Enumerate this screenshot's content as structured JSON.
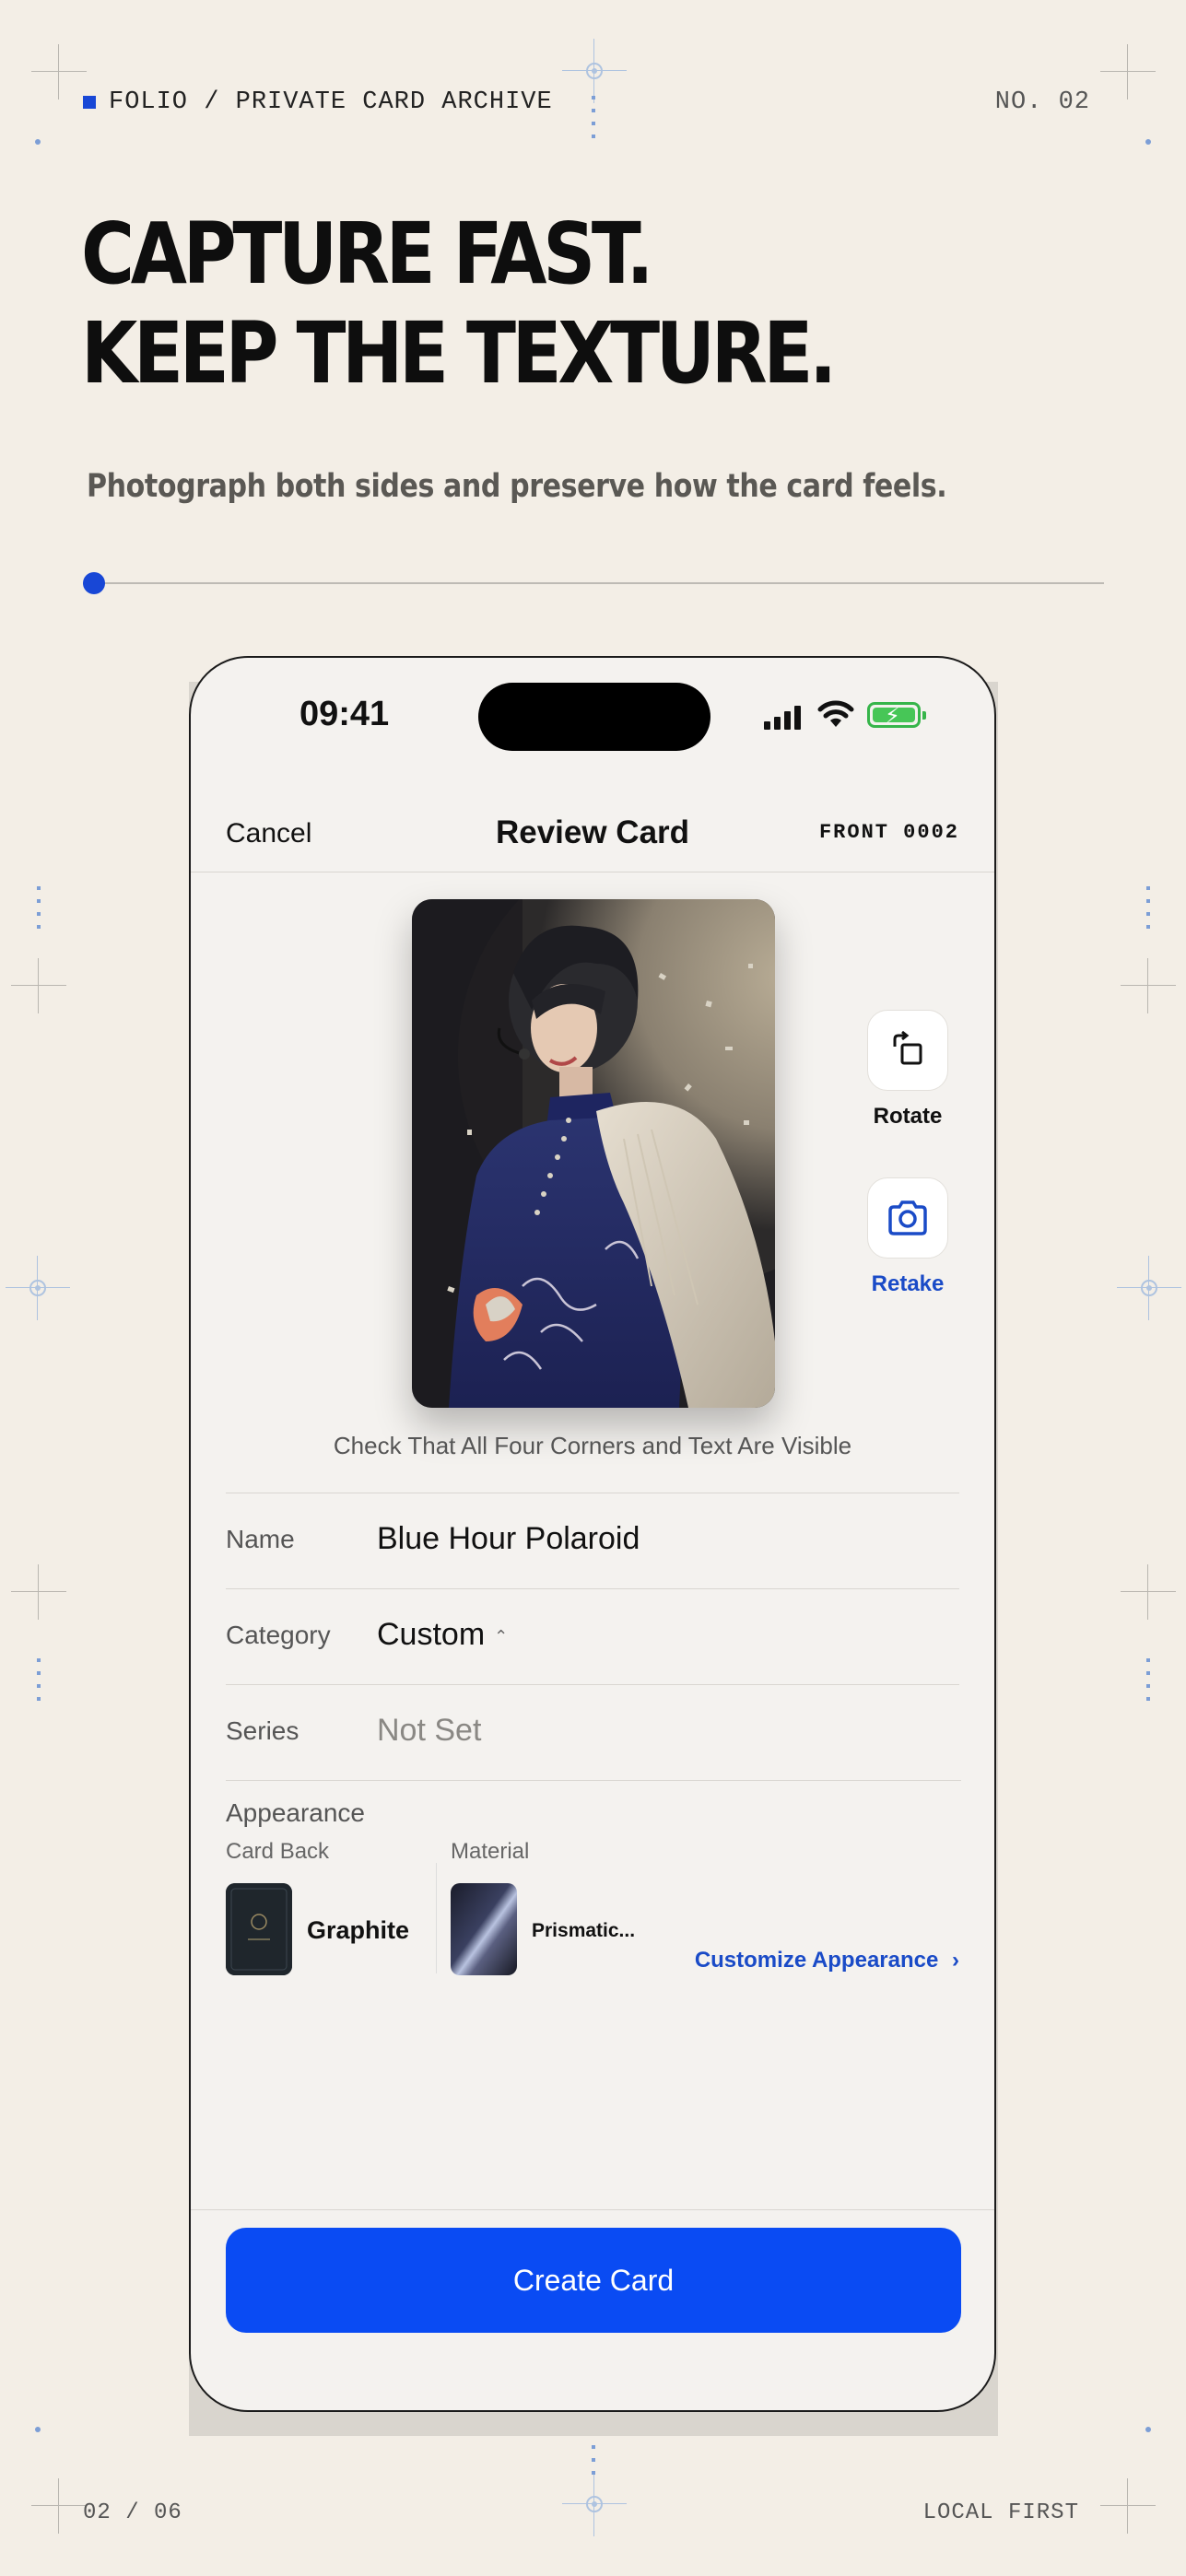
{
  "page": {
    "top_label": "FOLIO / PRIVATE CARD ARCHIVE",
    "top_right": "NO. 02",
    "headline_line1": "CAPTURE FAST.",
    "headline_line2": "KEEP THE TEXTURE.",
    "subhead": "Photograph both sides and preserve how the card feels.",
    "footer_left": "02 / 06",
    "footer_right": "LOCAL FIRST",
    "accent_color": "#1847d6"
  },
  "status_bar": {
    "time": "09:41",
    "icons": [
      "cellular-signal-icon",
      "wifi-icon",
      "battery-charging-icon"
    ]
  },
  "nav": {
    "cancel": "Cancel",
    "title": "Review Card",
    "side_label": "FRONT 0002"
  },
  "preview": {
    "rotate_label": "Rotate",
    "retake_label": "Retake",
    "hint": "Check That All Four Corners and Text Are Visible"
  },
  "fields": {
    "name_label": "Name",
    "name_value": "Blue Hour Polaroid",
    "category_label": "Category",
    "category_value": "Custom",
    "series_label": "Series",
    "series_value": "Not Set"
  },
  "appearance": {
    "title": "Appearance",
    "card_back_label": "Card Back",
    "card_back_value": "Graphite",
    "material_label": "Material",
    "material_value": "Prismatic...",
    "customize_link": "Customize Appearance"
  },
  "actions": {
    "create": "Create Card",
    "primary_color": "#0a4bf3"
  }
}
